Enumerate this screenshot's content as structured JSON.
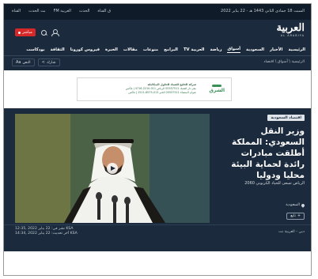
{
  "topbar": {
    "date": "السبت 18 جمادى الثاني 1443 هـ - 22 يناير 2022",
    "links": [
      "القناة",
      "بث الحدث",
      "العربية FM",
      "الحدث",
      "ق القناة"
    ]
  },
  "header": {
    "logo_ar": "العربية",
    "logo_en": "AL ARABIYA",
    "live_label": "مباشر"
  },
  "nav": {
    "items": [
      "الرئيسية",
      "الأخبار",
      "السعودية",
      "أسواق",
      "رياضة",
      "العربية TV",
      "البرامج",
      "منوعات",
      "مقالات",
      "الخبرة",
      "فيروس كورونا",
      "الثقافة",
      "بودكاست"
    ],
    "active_index": 3
  },
  "breadcrumb": "الرئيسية \\ أسواق \\ اقتصاد",
  "tools": {
    "font_label": "النص",
    "share_label": "شارك"
  },
  "ad": {
    "brand": "الشرق",
    "line1": "شركة الخليج للشبك للحلول المتكاملة",
    "line2": "مقر دار الشبك 05557511 الرياض 011-2210-4716 | فاكس",
    "line3": "عنوان المنشأة 05557511 الخبر 013-8575-1511 | فاكس"
  },
  "article": {
    "tag": "اقتصاد السعودية",
    "headline": "وزير النقل السعودي: المملكة أطلقت مبادرات رائدة لحماية البيئة محليا ودوليا",
    "subline": "الرياض تسعى للحياد الكربوني 2060",
    "country": "السعودية",
    "follow_label": "تابع",
    "published": "نشر في: 22 يناير 2022 ,12:35 KSA",
    "updated": "آخر تحديث: 22 يناير 2022 ,14:34 KSA",
    "source": "دبي - العربية نت"
  },
  "colors": {
    "background": "#1b2b3d",
    "live": "#d62828",
    "ad_green": "#3b8f57"
  }
}
